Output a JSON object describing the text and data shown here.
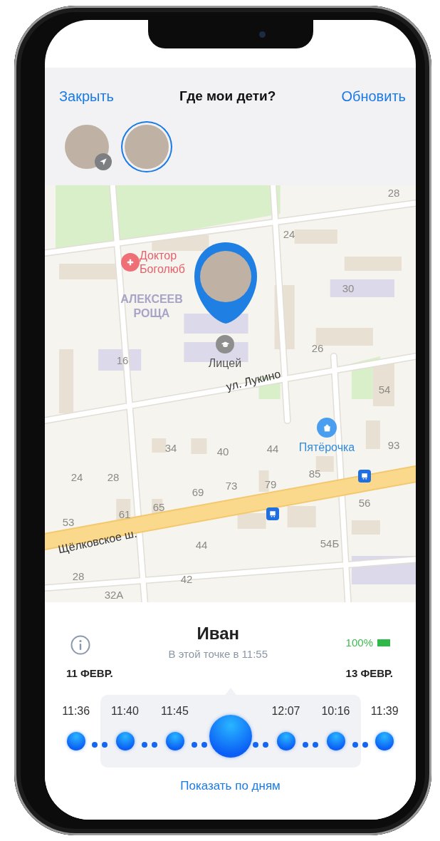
{
  "header": {
    "close_button": "Закрыть",
    "title": "Где мои дети?",
    "refresh_button": "Обновить"
  },
  "children": [
    {
      "selected": false,
      "location_badge": true
    },
    {
      "selected": true,
      "location_badge": false
    }
  ],
  "map": {
    "labels": [
      {
        "text": "28",
        "kind": "house"
      },
      {
        "text": "24",
        "kind": "house"
      },
      {
        "text": "Доктор Боголюб",
        "kind": "poi-medical"
      },
      {
        "text": "АЛЕКСЕЕВ РОЩА",
        "kind": "district"
      },
      {
        "text": "30",
        "kind": "house"
      },
      {
        "text": "16",
        "kind": "house"
      },
      {
        "text": "Лицей",
        "kind": "poi-school"
      },
      {
        "text": "26",
        "kind": "house"
      },
      {
        "text": "ул. Лукино",
        "kind": "street"
      },
      {
        "text": "54",
        "kind": "house"
      },
      {
        "text": "Пятёрочка",
        "kind": "poi-shop"
      },
      {
        "text": "93",
        "kind": "house"
      },
      {
        "text": "34",
        "kind": "house"
      },
      {
        "text": "40",
        "kind": "house"
      },
      {
        "text": "44",
        "kind": "house"
      },
      {
        "text": "24",
        "kind": "house"
      },
      {
        "text": "28",
        "kind": "house"
      },
      {
        "text": "85",
        "kind": "house"
      },
      {
        "text": "69",
        "kind": "house"
      },
      {
        "text": "73",
        "kind": "house"
      },
      {
        "text": "79",
        "kind": "house"
      },
      {
        "text": "56",
        "kind": "house"
      },
      {
        "text": "61",
        "kind": "house"
      },
      {
        "text": "65",
        "kind": "house"
      },
      {
        "text": "53",
        "kind": "house"
      },
      {
        "text": "Щёлковское ш.",
        "kind": "street"
      },
      {
        "text": "44",
        "kind": "house"
      },
      {
        "text": "54Б",
        "kind": "house"
      },
      {
        "text": "28",
        "kind": "house"
      },
      {
        "text": "42",
        "kind": "house"
      },
      {
        "text": "32А",
        "kind": "house"
      }
    ]
  },
  "panel": {
    "name": "Иван",
    "subtitle": "В этой точке в 11:55",
    "battery": "100%",
    "date_start": "11 ФЕВР.",
    "date_end": "13 ФЕВР.",
    "points": [
      {
        "time": "11:36",
        "selected": false
      },
      {
        "time": "11:40",
        "selected": false
      },
      {
        "time": "11:45",
        "selected": false
      },
      {
        "selected": true
      },
      {
        "time": "12:07",
        "selected": false
      },
      {
        "time": "10:16",
        "selected": false
      },
      {
        "time": "11:39",
        "selected": false
      }
    ],
    "link": "Показать по дням"
  }
}
